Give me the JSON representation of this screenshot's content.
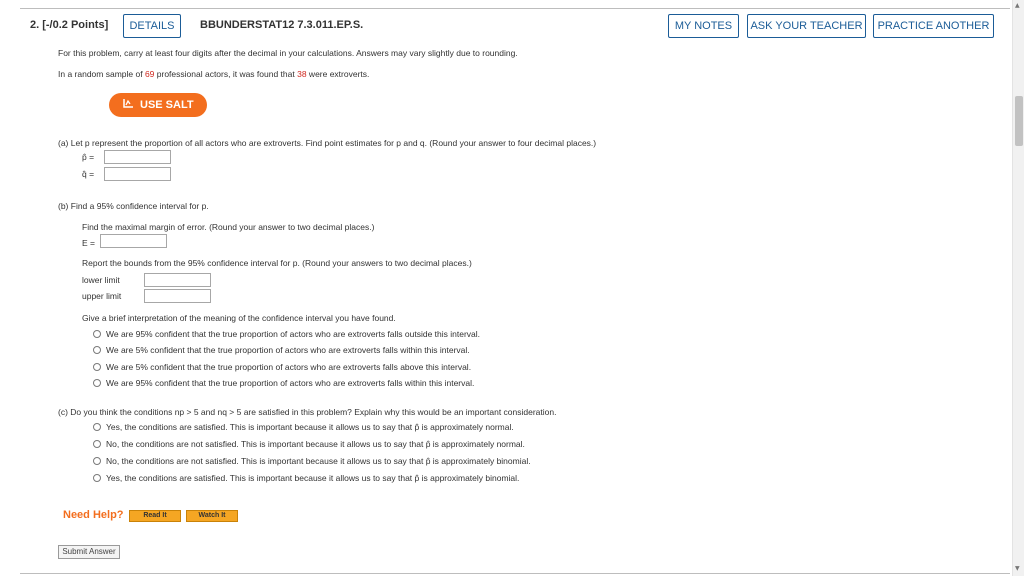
{
  "header": {
    "question_number": "2. [-/0.2 Points]",
    "details_label": "DETAILS",
    "problem_code": "BBUNDERSTAT12 7.3.011.EP.S.",
    "my_notes_label": "MY NOTES",
    "ask_teacher_label": "ASK YOUR TEACHER",
    "practice_another_label": "PRACTICE ANOTHER"
  },
  "intro": {
    "line1": "For this problem, carry at least four digits after the decimal in your calculations. Answers may vary slightly due to rounding.",
    "line2_a": "In a random sample of ",
    "n": "69",
    "line2_b": " professional actors, it was found that ",
    "x": "38",
    "line2_c": " were extroverts."
  },
  "salt_label": "USE SALT",
  "part_a": {
    "prompt": "(a)   Let p represent the proportion of all actors who are extroverts. Find point estimates for p and q. (Round your answer to four decimal places.)",
    "p_hat_label": "p̂  =",
    "q_hat_label": "q̂  ="
  },
  "part_b": {
    "prompt": "(b)   Find a 95% confidence interval for p.",
    "margin_prompt": "Find the maximal margin of error. (Round your answer to two decimal places.)",
    "e_label": "E =",
    "bounds_prompt": "Report the bounds from the 95% confidence interval for p. (Round your answers to two decimal places.)",
    "lower_label": "lower limit",
    "upper_label": "upper limit",
    "interp_prompt": "Give a brief interpretation of the meaning of the confidence interval you have found.",
    "options": [
      "We are 95% confident that the true proportion of actors who are extroverts falls outside this interval.",
      "We are 5% confident that the true proportion of actors who are extroverts falls within this interval.",
      "We are 5% confident that the true proportion of actors who are extroverts falls above this interval.",
      "We are 95% confident that the true proportion of actors who are extroverts falls within this interval."
    ]
  },
  "part_c": {
    "prompt": "(c)   Do you think the conditions np > 5 and nq > 5 are satisfied in this problem? Explain why this would be an important consideration.",
    "options": [
      "Yes, the conditions are satisfied. This is important because it allows us to say that p̂ is approximately normal.",
      "No, the conditions are not satisfied. This is important because it allows us to say that p̂ is approximately normal.",
      "No, the conditions are not satisfied. This is important because it allows us to say that p̂ is approximately binomial.",
      "Yes, the conditions are satisfied. This is important because it allows us to say that p̂ is approximately binomial."
    ]
  },
  "help": {
    "label": "Need Help?",
    "read_it": "Read It",
    "watch_it": "Watch It"
  },
  "submit_label": "Submit Answer",
  "colors": {
    "accent_blue": "#1b5c97",
    "salt_orange": "#f36e1e",
    "value_red": "#d0281f",
    "help_orange": "#f5a623"
  }
}
